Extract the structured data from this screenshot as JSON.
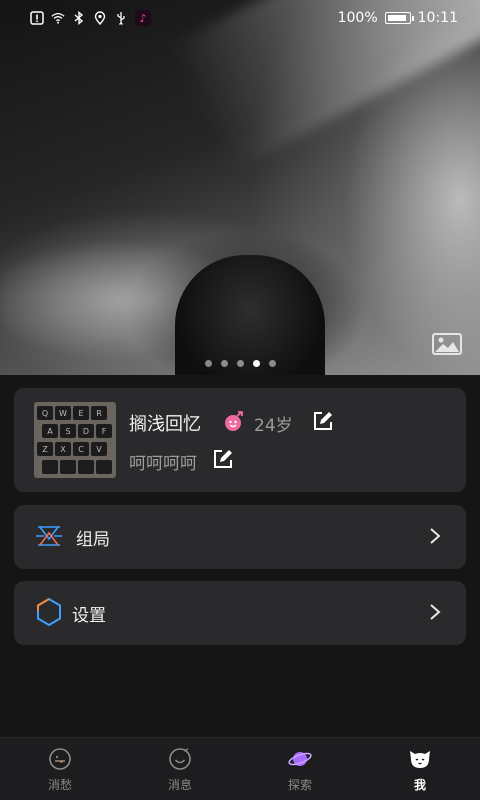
{
  "status_bar": {
    "battery_text": "100%",
    "time": "10:11",
    "battery_level": 1.0,
    "left_icons": [
      "alert-icon",
      "wifi-icon",
      "bluetooth-icon",
      "location-icon",
      "usb-icon",
      "tiktok-icon"
    ]
  },
  "hero": {
    "carousel_total": 5,
    "carousel_active": 4
  },
  "profile": {
    "nickname": "搁浅回忆",
    "age": "24岁",
    "signature": "呵呵呵呵",
    "gender_icon": "female-icon"
  },
  "menu": [
    {
      "label": "组局",
      "icon": "group-event-icon"
    },
    {
      "label": "设置",
      "icon": "hexagon-settings-icon"
    }
  ],
  "bottom_nav": [
    {
      "label": "消愁",
      "icon": "face-tongue-icon",
      "active": false
    },
    {
      "label": "消息",
      "icon": "smile-bubble-icon",
      "active": false
    },
    {
      "label": "探索",
      "icon": "planet-icon",
      "active": false
    },
    {
      "label": "我",
      "icon": "cat-face-icon",
      "active": true
    }
  ],
  "colors": {
    "background": "#151516",
    "card": "#2a2a2c",
    "accent_blue": "#3aa0ff",
    "accent_purple": "#a86bff",
    "pink": "#f06aa0"
  }
}
